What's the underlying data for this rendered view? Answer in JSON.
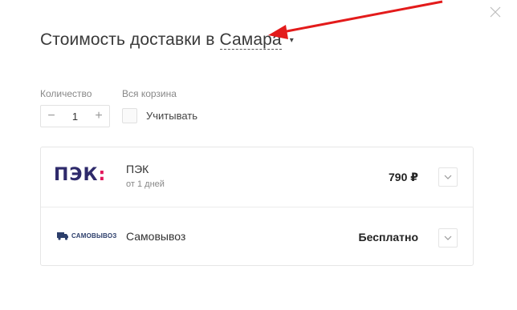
{
  "modal": {
    "title_prefix": "Стоимость доставки в",
    "city": "Самара",
    "close_icon": "close-icon"
  },
  "quantity": {
    "label": "Количество",
    "value": "1"
  },
  "cart": {
    "label": "Вся корзина",
    "checkbox_label": "Учитывать",
    "checked": false
  },
  "delivery_options": [
    {
      "logo_text": "ПЭК:",
      "name": "ПЭК",
      "sub": "от 1 дней",
      "price": "790 ₽"
    },
    {
      "logo_text": "САМОВЫВОЗ",
      "name": "Самовывоз",
      "price": "Бесплатно"
    }
  ],
  "colors": {
    "pek_navy": "#2e2a6b",
    "pek_pink": "#e2165b",
    "arrow_red": "#e31b1b"
  }
}
